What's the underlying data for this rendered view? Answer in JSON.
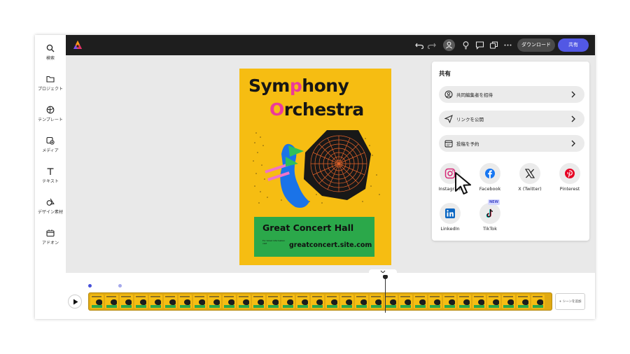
{
  "sidebar": {
    "items": [
      {
        "label": "検索",
        "icon": "search-icon"
      },
      {
        "label": "プロジェクト",
        "icon": "folder-icon"
      },
      {
        "label": "テンプレート",
        "icon": "template-icon"
      },
      {
        "label": "メディア",
        "icon": "media-icon"
      },
      {
        "label": "テキスト",
        "icon": "text-icon"
      },
      {
        "label": "デザイン素材",
        "icon": "shapes-icon"
      },
      {
        "label": "アドオン",
        "icon": "addon-icon"
      }
    ]
  },
  "topbar": {
    "download_label": "ダウンロード",
    "share_label": "共有"
  },
  "poster": {
    "title_line1_a": "Sym",
    "title_line1_b": "p",
    "title_line1_c": "hony",
    "title_line2_a": "O",
    "title_line2_b": "rchestra",
    "venue": "Great Concert Hall",
    "info": "For ticket information visit",
    "site": "greatconcert.site.com"
  },
  "share_panel": {
    "title": "共有",
    "rows": [
      {
        "label": "共同編集者を招待",
        "icon": "invite-collaborator-icon"
      },
      {
        "label": "リンクを公開",
        "icon": "send-link-icon"
      },
      {
        "label": "投稿を予約",
        "icon": "calendar-icon"
      }
    ],
    "socials": [
      {
        "label": "Instagram",
        "icon": "instagram-icon"
      },
      {
        "label": "Facebook",
        "icon": "facebook-icon"
      },
      {
        "label": "X (Twitter)",
        "icon": "x-twitter-icon"
      },
      {
        "label": "Pinterest",
        "icon": "pinterest-icon"
      },
      {
        "label": "LinkedIn",
        "icon": "linkedin-icon"
      },
      {
        "label": "TikTok",
        "icon": "tiktok-icon",
        "badge": "NEW"
      }
    ]
  },
  "timeline": {
    "add_scene_label": "+ シーンを追加"
  },
  "colors": {
    "accent": "#5258e4",
    "poster_bg": "#f6bd12",
    "poster_green": "#2ba84a",
    "poster_pink": "#ec3a9a"
  }
}
